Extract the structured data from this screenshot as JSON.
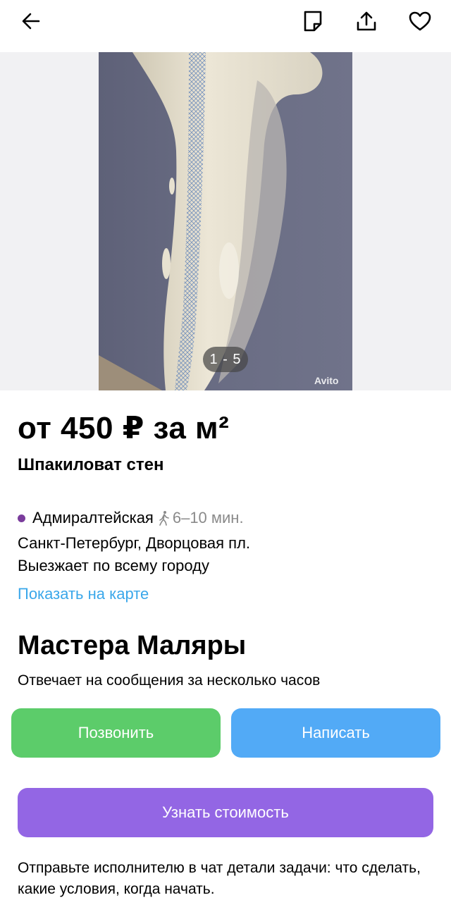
{
  "header": {
    "back_icon": "arrow-left-icon",
    "note_icon": "note-icon",
    "share_icon": "share-icon",
    "favorite_icon": "heart-icon"
  },
  "gallery": {
    "counter": "1 - 5",
    "watermark": "Avito"
  },
  "listing": {
    "price": "от 450 ₽ за м²",
    "title": "Шпакиловат стен",
    "metro_station": "Адмиралтейская",
    "metro_time": "6–10 мин.",
    "metro_color": "#7a3c9c",
    "address": "Санкт-Петербург, Дворцовая пл.",
    "travel": "Выезжает по всему городу",
    "map_link": "Показать на карте"
  },
  "seller": {
    "name": "Мастера Маляры",
    "response": "Отвечает на сообщения за несколько часов"
  },
  "actions": {
    "call": "Позвонить",
    "write": "Написать",
    "price": "Узнать стоимость"
  },
  "hint": "Отправьте исполнителю в чат детали задачи: что сделать, какие условия, когда начать.",
  "colors": {
    "call": "#5ccc6a",
    "write": "#52aaf6",
    "price": "#9366e4",
    "link": "#3aa7ea"
  }
}
